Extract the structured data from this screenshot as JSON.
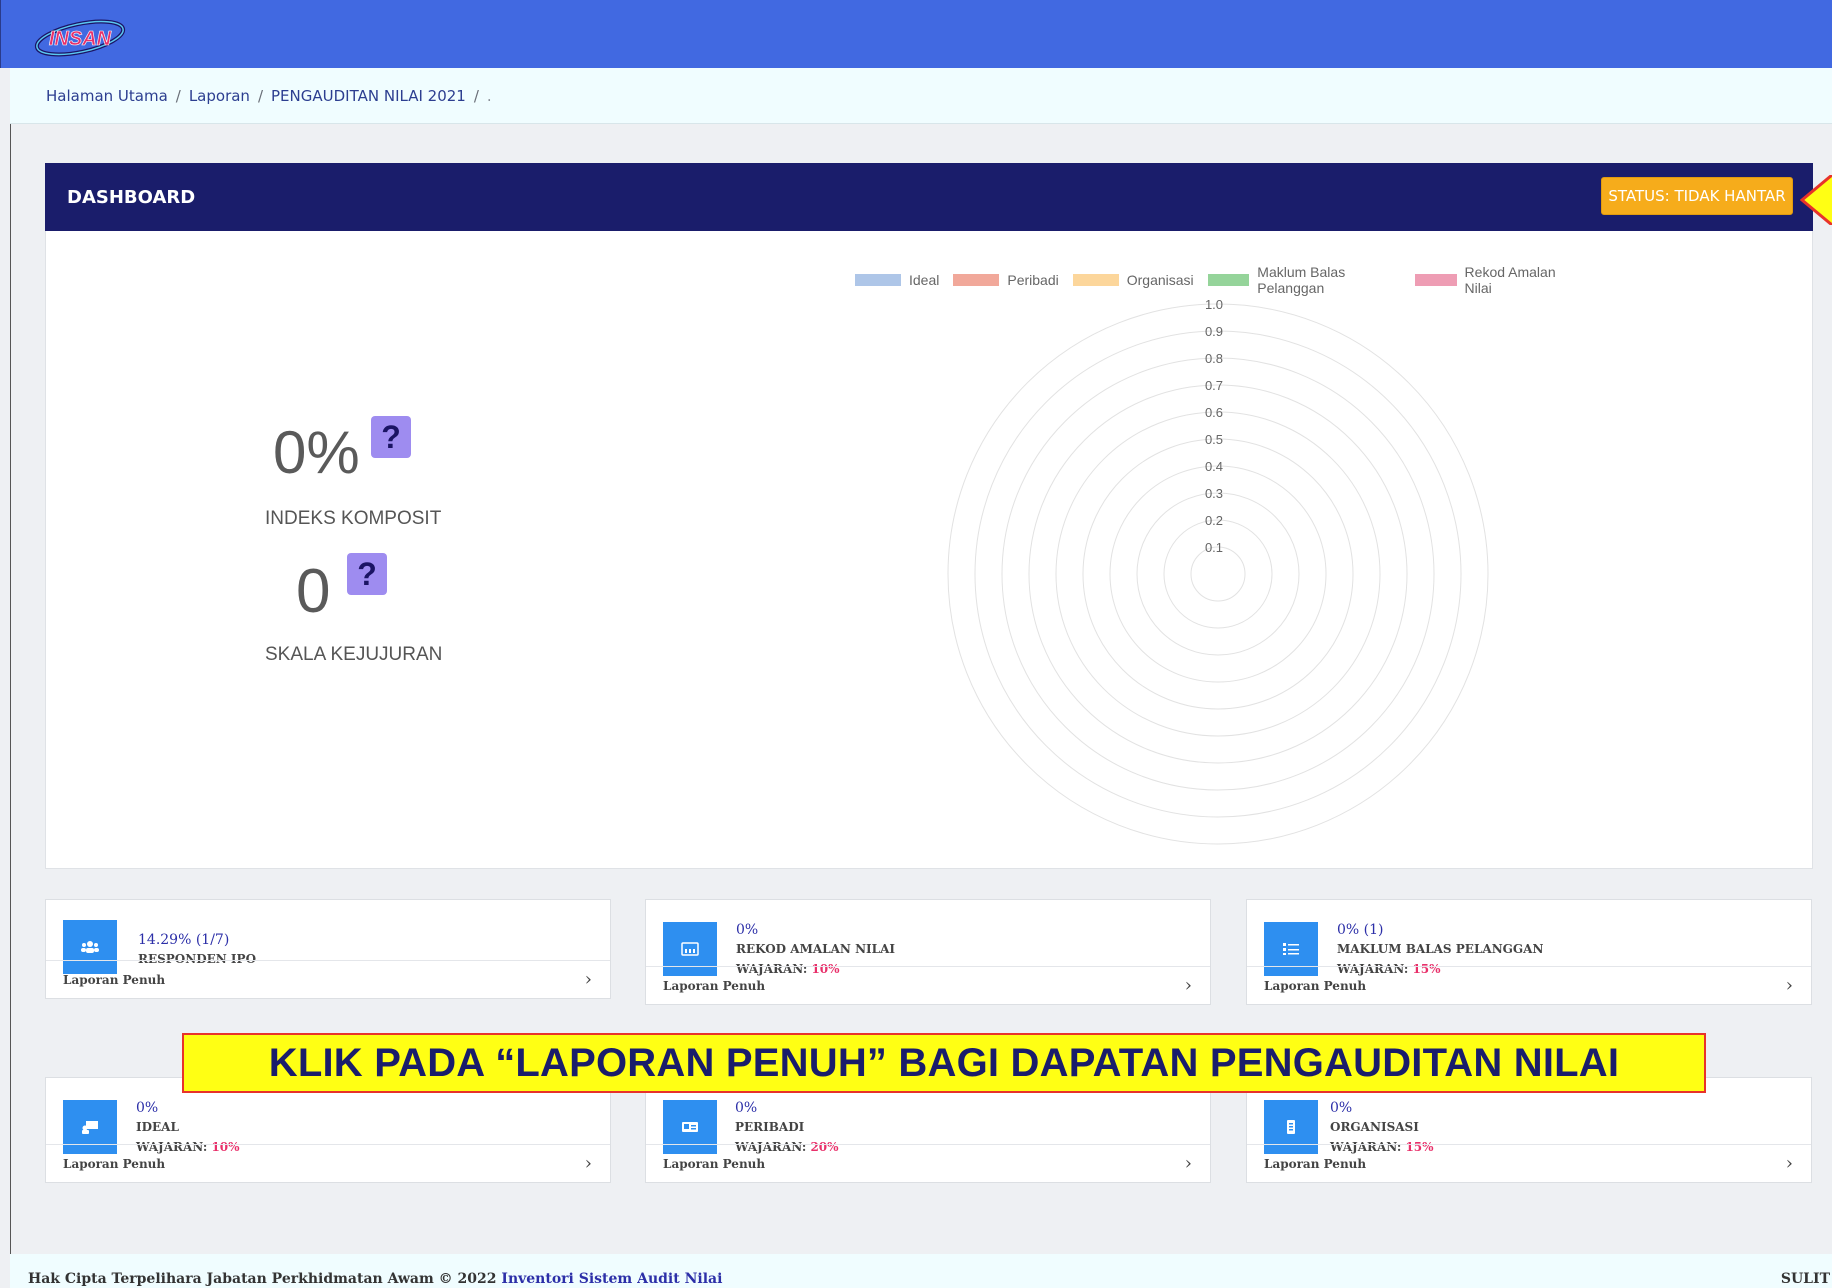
{
  "header": {
    "logo_text": "INSAN",
    "colors": {
      "topbar": "#4169e1",
      "dashboard_header": "#1a1d6b",
      "status": "#f6ac1b",
      "icon_tile": "#2e8ff0"
    }
  },
  "breadcrumb": {
    "items": [
      "Halaman Utama",
      "Laporan",
      "PENGAUDITAN NILAI 2021"
    ],
    "trailing": "."
  },
  "dashboard": {
    "title": "DASHBOARD",
    "status_label": "STATUS: TIDAK HANTAR",
    "indeks_value": "0%",
    "indeks_label": "INDEKS KOMPOSIT",
    "skala_value": "0",
    "skala_label": "SKALA KEJUJURAN",
    "help_glyph": "?"
  },
  "chart_data": {
    "type": "radar",
    "legend": [
      {
        "name": "Ideal",
        "color": "#aec6e8"
      },
      {
        "name": "Peribadi",
        "color": "#f1a89a"
      },
      {
        "name": "Organisasi",
        "color": "#fcd69b"
      },
      {
        "name": "Maklum Balas Pelanggan",
        "color": "#95d49a"
      },
      {
        "name": "Rekod Amalan Nilai",
        "color": "#ee9db4"
      }
    ],
    "ticks": [
      "0.1",
      "0.2",
      "0.3",
      "0.4",
      "0.5",
      "0.6",
      "0.7",
      "0.8",
      "0.9",
      "1.0"
    ],
    "rlim": [
      0,
      1.0
    ],
    "grid": true,
    "legend_position": "top"
  },
  "cards": [
    {
      "value": "14.29% (1/7)",
      "label": "RESPONDEN IPO",
      "weight_label": "",
      "weight_value": "",
      "footer": "Laporan Penuh",
      "icon": "users-icon"
    },
    {
      "value": "0%",
      "label": "REKOD AMALAN NILAI",
      "weight_label": "WAJARAN:",
      "weight_value": "10%",
      "footer": "Laporan Penuh",
      "icon": "records-icon"
    },
    {
      "value": "0% (1)",
      "label": "MAKLUM BALAS PELANGGAN",
      "weight_label": "WAJARAN:",
      "weight_value": "15%",
      "footer": "Laporan Penuh",
      "icon": "list-icon"
    },
    {
      "value": "0%",
      "label": "IDEAL",
      "weight_label": "WAJARAN:",
      "weight_value": "10%",
      "footer": "Laporan Penuh",
      "icon": "presentation-icon"
    },
    {
      "value": "0%",
      "label": "PERIBADI",
      "weight_label": "WAJARAN:",
      "weight_value": "20%",
      "footer": "Laporan Penuh",
      "icon": "id-card-icon"
    },
    {
      "value": "0%",
      "label": "ORGANISASI",
      "weight_label": "WAJARAN:",
      "weight_value": "15%",
      "footer": "Laporan Penuh",
      "icon": "document-icon"
    }
  ],
  "banner": {
    "text": "KLIK PADA “LAPORAN PENUH” BAGI DAPATAN PENGAUDITAN NILAI"
  },
  "footer": {
    "text": "Hak Cipta Terpelihara Jabatan Perkhidmatan Awam © 2022",
    "link": "Inventori Sistem Audit Nilai",
    "right": "SULIT"
  }
}
